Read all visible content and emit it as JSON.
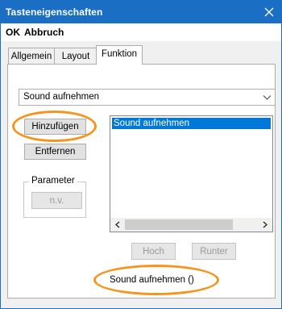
{
  "window": {
    "title": "Tasteneigenschaften"
  },
  "menu": {
    "ok": "OK",
    "cancel": "Abbruch"
  },
  "tabs": [
    {
      "label": "Allgemein"
    },
    {
      "label": "Layout"
    },
    {
      "label": "Funktion",
      "active": true
    }
  ],
  "function_panel": {
    "combo_value": "Sound aufnehmen",
    "add_button": "Hinzufügen",
    "remove_button": "Entfernen",
    "parameter_group": "Parameter",
    "parameter_button": "n.v.",
    "list_items": [
      "Sound aufnehmen"
    ],
    "up_button": "Hoch",
    "down_button": "Runter",
    "summary": "Sound aufnehmen ()"
  },
  "colors": {
    "titlebar": "#1a6fc4",
    "selection": "#0078d7",
    "highlight": "#f7941d"
  },
  "icons": [
    "close-icon",
    "chevron-down-icon",
    "chevron-left-icon",
    "chevron-right-icon"
  ]
}
